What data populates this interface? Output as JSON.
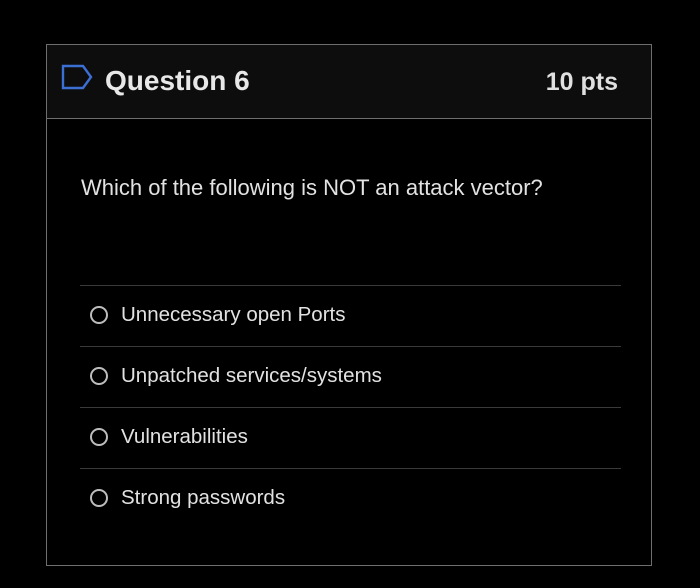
{
  "question": {
    "title": "Question 6",
    "points": "10 pts",
    "flag_icon": "flag-outline-icon",
    "text": "Which of the following is NOT an attack vector?",
    "answers": [
      {
        "label": "Unnecessary open Ports",
        "selected": false
      },
      {
        "label": "Unpatched services/systems",
        "selected": false
      },
      {
        "label": "Vulnerabilities",
        "selected": false
      },
      {
        "label": "Strong passwords",
        "selected": false
      }
    ]
  },
  "colors": {
    "background": "#000000",
    "border": "#6e6e6e",
    "text": "#e2e2e2",
    "flag_icon": "#3b6fd4"
  }
}
